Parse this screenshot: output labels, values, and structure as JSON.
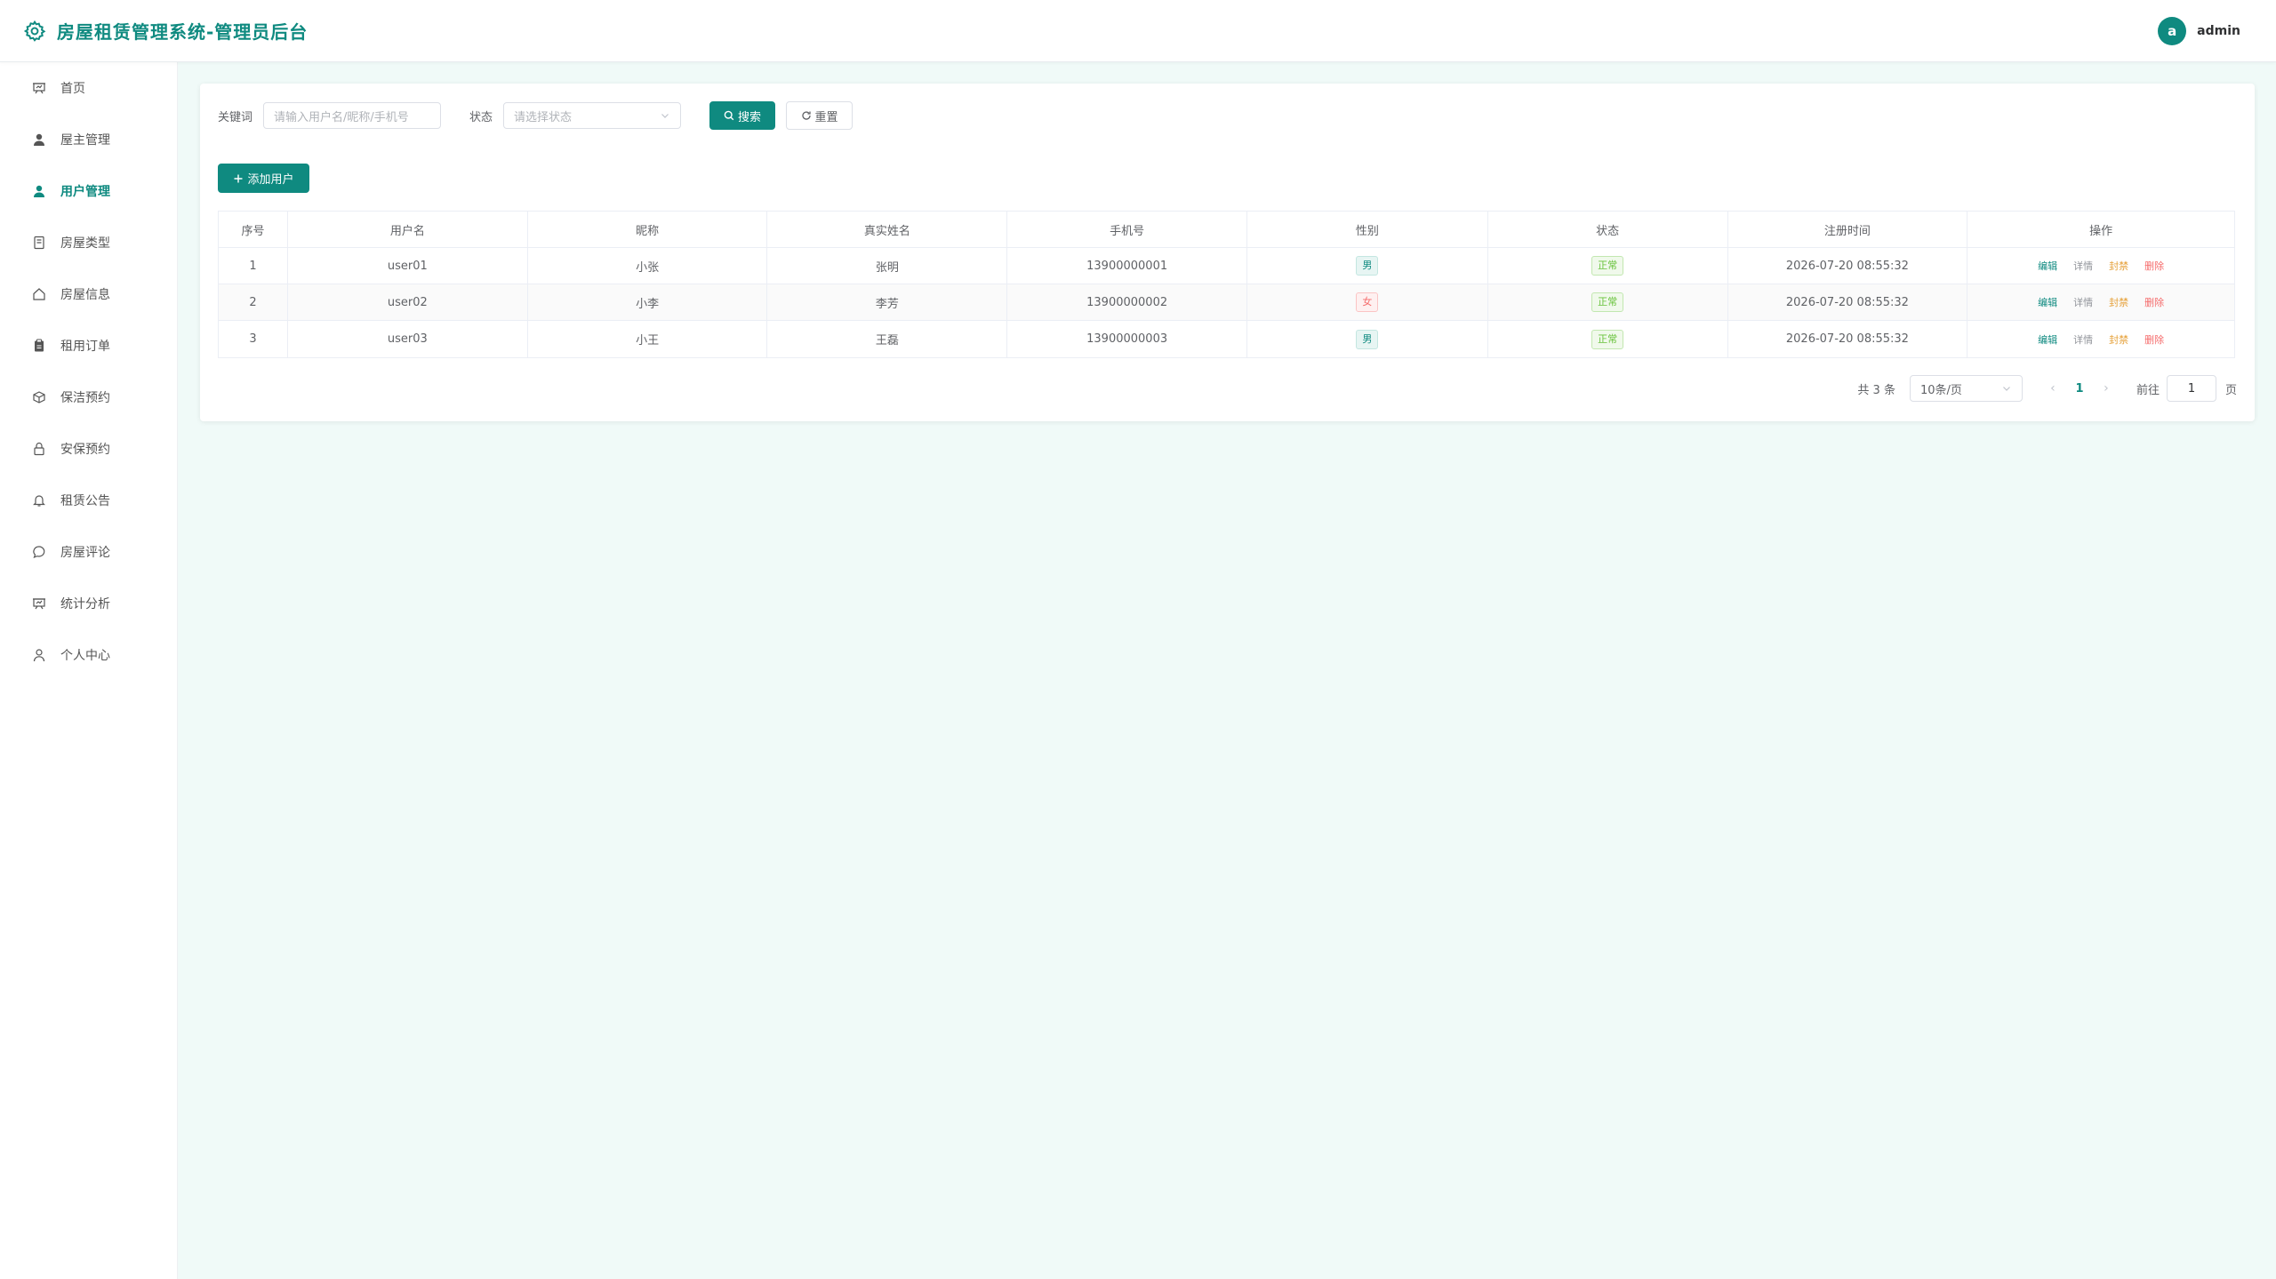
{
  "app": {
    "title": "房屋租赁管理系统-管理员后台",
    "user": "admin",
    "avatar_letter": "a"
  },
  "colors": {
    "accent": "#0f8a80",
    "background": "#f0faf8"
  },
  "sidebar": {
    "items": [
      {
        "label": "首页",
        "icon": "presentation-icon",
        "active": false
      },
      {
        "label": "屋主管理",
        "icon": "user-filled-icon",
        "active": false
      },
      {
        "label": "用户管理",
        "icon": "user-filled-icon",
        "active": true
      },
      {
        "label": "房屋类型",
        "icon": "notebook-icon",
        "active": false
      },
      {
        "label": "房屋信息",
        "icon": "house-icon",
        "active": false
      },
      {
        "label": "租用订单",
        "icon": "clipboard-icon",
        "active": false
      },
      {
        "label": "保洁预约",
        "icon": "box-icon",
        "active": false
      },
      {
        "label": "安保预约",
        "icon": "lock-icon",
        "active": false
      },
      {
        "label": "租赁公告",
        "icon": "bell-icon",
        "active": false
      },
      {
        "label": "房屋评论",
        "icon": "chat-icon",
        "active": false
      },
      {
        "label": "统计分析",
        "icon": "presentation-icon",
        "active": false
      },
      {
        "label": "个人中心",
        "icon": "user-outline-icon",
        "active": false
      }
    ]
  },
  "search": {
    "keyword_label": "关键词",
    "keyword_placeholder": "请输入用户名/昵称/手机号",
    "status_label": "状态",
    "status_placeholder": "请选择状态",
    "search_button": "搜索",
    "reset_button": "重置"
  },
  "add_button": "添加用户",
  "table": {
    "columns": [
      "序号",
      "用户名",
      "昵称",
      "真实姓名",
      "手机号",
      "性别",
      "状态",
      "注册时间",
      "操作"
    ],
    "rows": [
      {
        "index": "1",
        "username": "user01",
        "nickname": "小张",
        "realname": "张明",
        "phone": "13900000001",
        "gender": "男",
        "status": "正常",
        "registered": "2026-07-20 08:55:32"
      },
      {
        "index": "2",
        "username": "user02",
        "nickname": "小李",
        "realname": "李芳",
        "phone": "13900000002",
        "gender": "女",
        "status": "正常",
        "registered": "2026-07-20 08:55:32"
      },
      {
        "index": "3",
        "username": "user03",
        "nickname": "小王",
        "realname": "王磊",
        "phone": "13900000003",
        "gender": "男",
        "status": "正常",
        "registered": "2026-07-20 08:55:32"
      }
    ],
    "actions": {
      "edit": "编辑",
      "detail": "详情",
      "ban": "封禁",
      "delete": "删除"
    }
  },
  "pagination": {
    "total_text": "共 3 条",
    "page_size": "10条/页",
    "current_page": "1",
    "goto_label": "前往",
    "goto_value": "1",
    "page_suffix": "页"
  }
}
